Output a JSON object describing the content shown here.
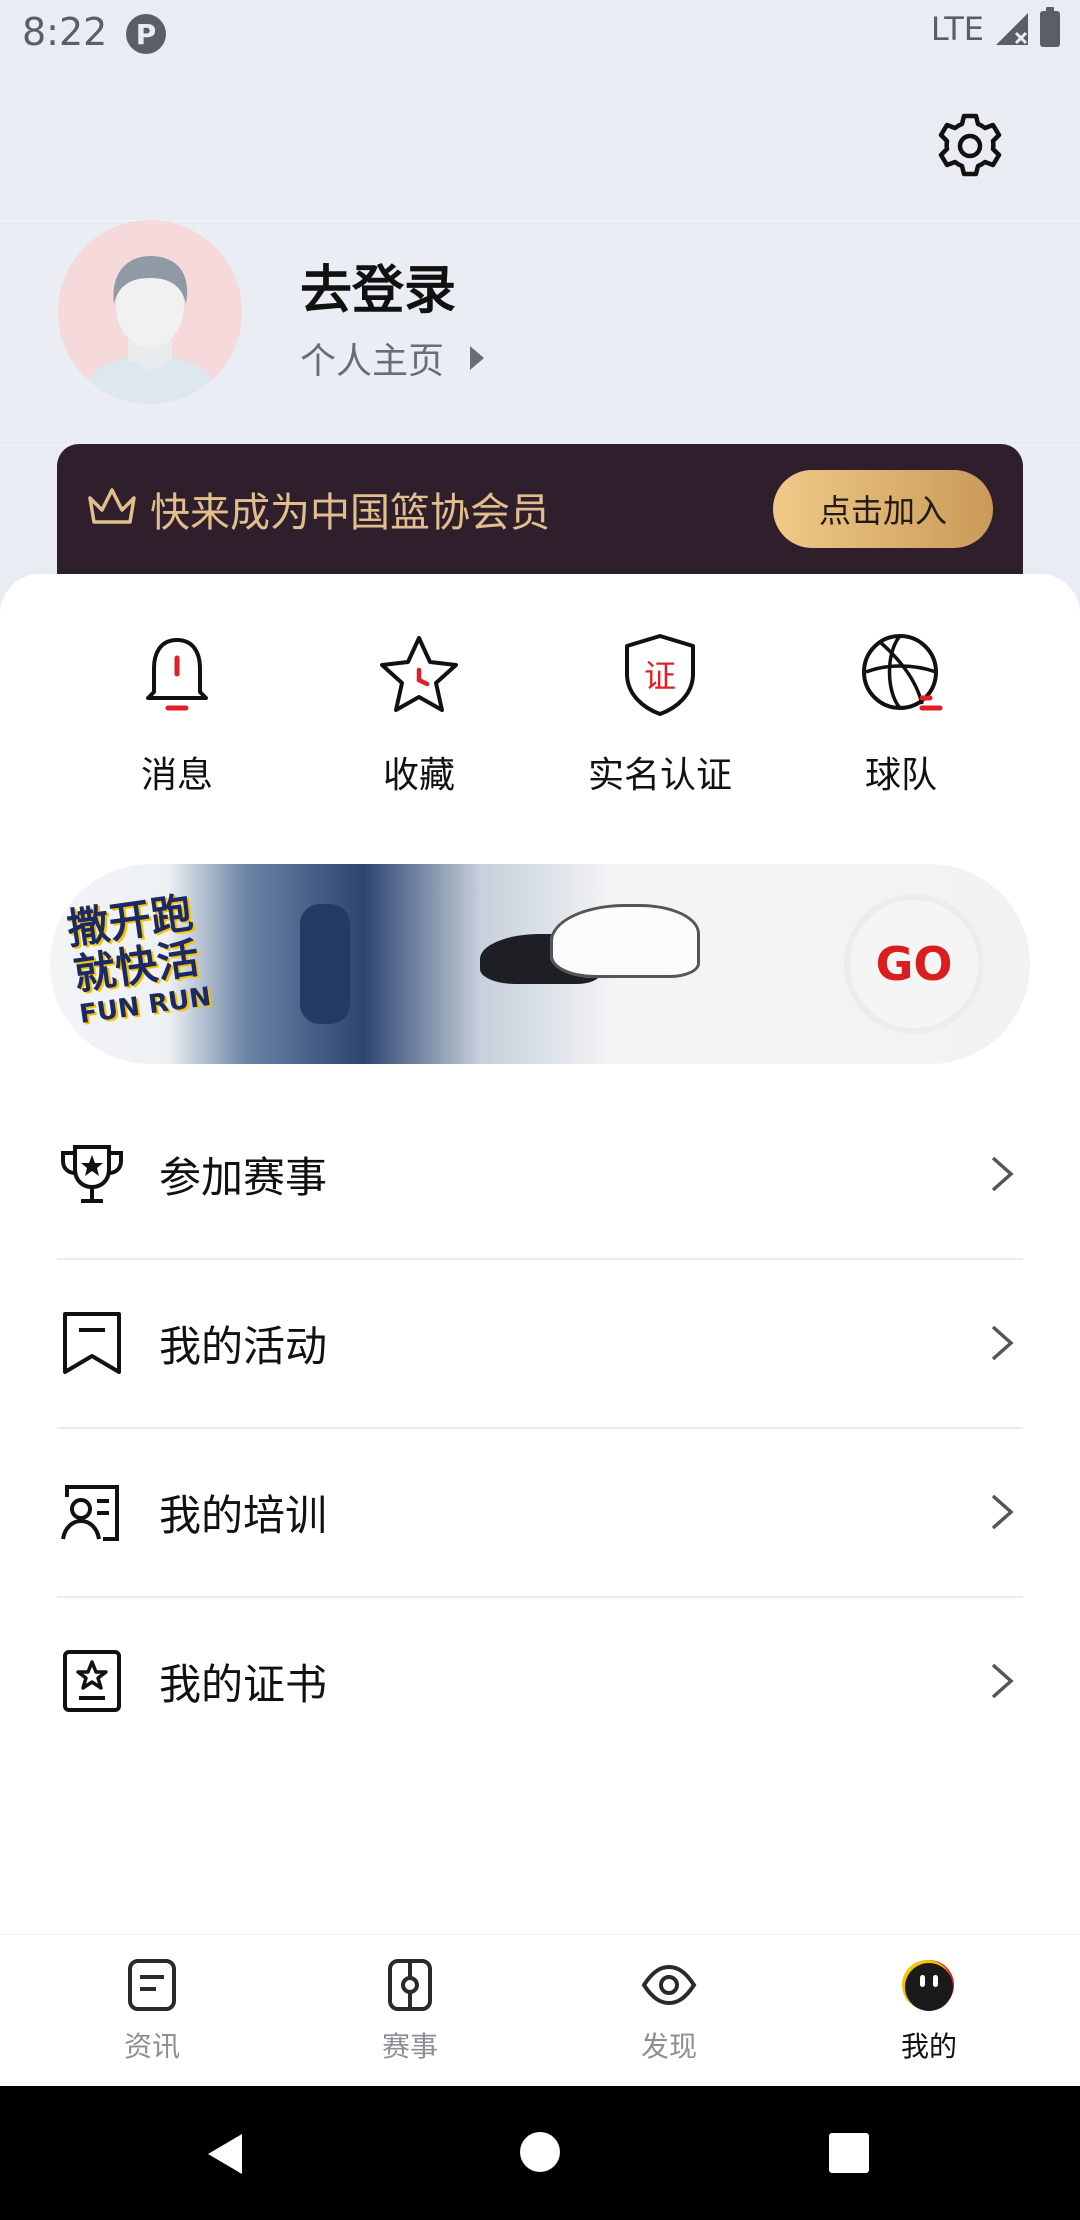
{
  "status": {
    "time": "8:22",
    "app_logo_glyph": "P",
    "network": "LTE"
  },
  "profile": {
    "title": "去登录",
    "homepage_link": "个人主页"
  },
  "membership": {
    "text": "快来成为中国篮协会员",
    "button": "点击加入"
  },
  "quick_actions": [
    {
      "label": "消息",
      "icon": "bell-icon"
    },
    {
      "label": "收藏",
      "icon": "star-icon"
    },
    {
      "label": "实名认证",
      "icon": "shield-id-icon",
      "glyph": "证"
    },
    {
      "label": "球队",
      "icon": "basketball-icon"
    }
  ],
  "banner": {
    "cta": "GO",
    "lines": [
      "撒开跑",
      "就快活",
      "FUN RUN"
    ]
  },
  "menu": [
    {
      "label": "参加赛事",
      "icon": "trophy-icon"
    },
    {
      "label": "我的活动",
      "icon": "bookmark-icon"
    },
    {
      "label": "我的培训",
      "icon": "training-icon"
    },
    {
      "label": "我的证书",
      "icon": "certificate-icon"
    }
  ],
  "tabs": [
    {
      "label": "资讯",
      "icon": "news-icon",
      "active": false
    },
    {
      "label": "赛事",
      "icon": "match-icon",
      "active": false
    },
    {
      "label": "发现",
      "icon": "eye-icon",
      "active": false
    },
    {
      "label": "我的",
      "icon": "mine-face-icon",
      "active": true
    }
  ],
  "colors": {
    "accent_red": "#e11d26",
    "member_bg": "#2f1f2c",
    "member_gold": "#e2be8c"
  }
}
